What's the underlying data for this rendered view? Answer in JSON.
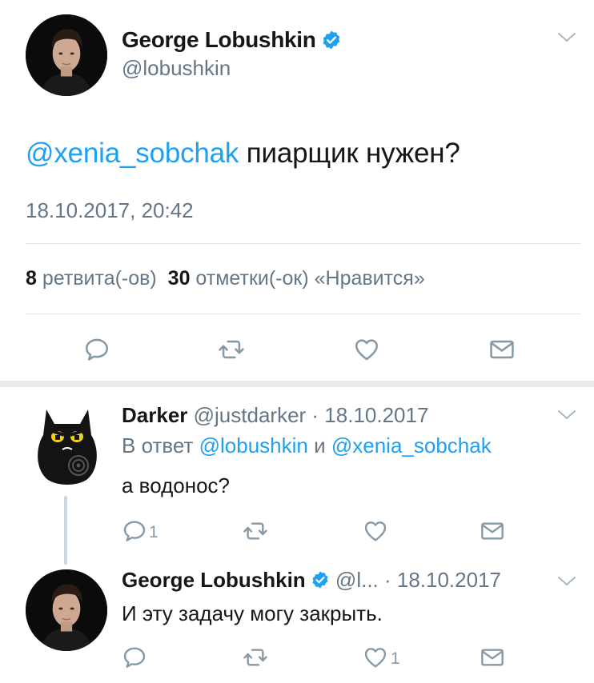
{
  "main_tweet": {
    "author_name": "George Lobushkin",
    "author_handle": "@lobushkin",
    "mention": "@xenia_sobchak",
    "text": " пиарщик нужен?",
    "timestamp": "18.10.2017, 20:42",
    "retweets_count": "8",
    "retweets_label": " ретвита(-ов)",
    "likes_count": "30",
    "likes_label": " отметки(-ок) «Нравится»"
  },
  "replies": [
    {
      "author_name": "Darker",
      "author_handle": "@justdarker",
      "date": " · 18.10.2017",
      "reply_to_prefix": "В ответ ",
      "reply_to_user1": "@lobushkin",
      "reply_to_conj": " и ",
      "reply_to_user2": "@xenia_sobchak",
      "text": "а водонос?",
      "reply_count": "1",
      "retweet_count": "",
      "like_count": ""
    },
    {
      "author_name": "George Lobushkin",
      "author_handle": "@l...",
      "date": " · 18.10.2017",
      "text": "И эту задачу могу закрыть.",
      "reply_count": "",
      "retweet_count": "",
      "like_count": "1"
    }
  ],
  "colors": {
    "accent": "#1da1f2",
    "text_primary": "#14171a",
    "text_secondary": "#657786",
    "icon_gray": "#8899a6",
    "divider": "#e1e8ed"
  },
  "icons": [
    "verified-badge-icon",
    "chevron-down-icon",
    "reply-icon",
    "retweet-icon",
    "like-icon",
    "direct-message-icon"
  ]
}
